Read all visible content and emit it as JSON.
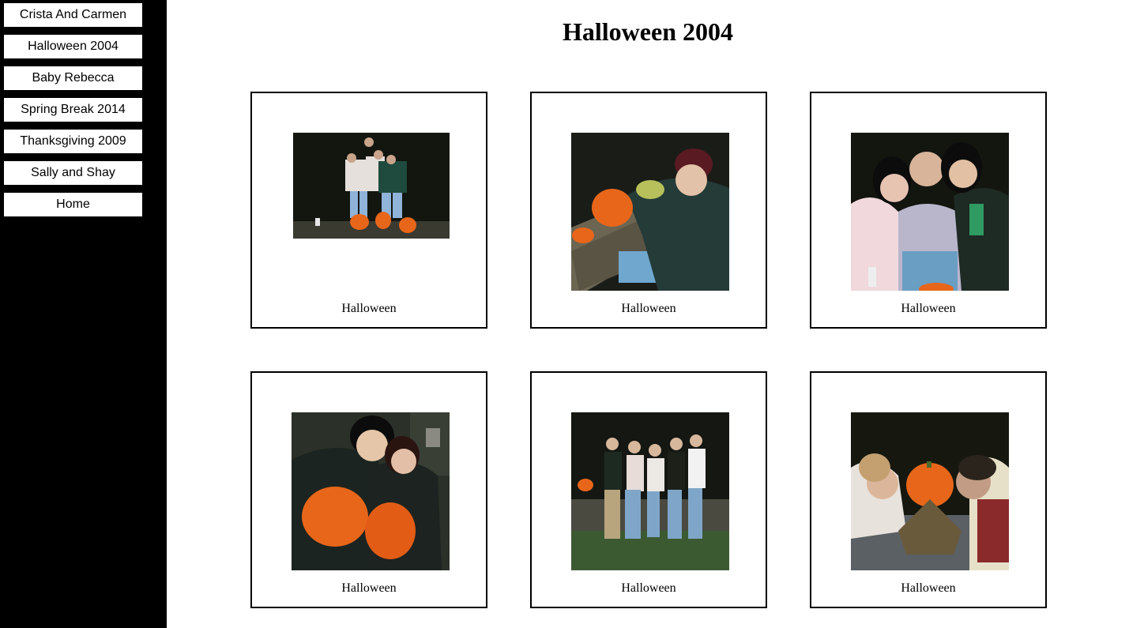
{
  "sidebar": {
    "items": [
      {
        "label": "Crista And Carmen"
      },
      {
        "label": "Halloween 2004"
      },
      {
        "label": "Baby Rebecca"
      },
      {
        "label": "Spring Break 2014"
      },
      {
        "label": "Thanksgiving 2009"
      },
      {
        "label": "Sally and Shay"
      },
      {
        "label": "Home"
      }
    ]
  },
  "page": {
    "title": "Halloween 2004"
  },
  "gallery": {
    "cards": [
      {
        "caption": "Halloween",
        "image": "group-photo-with-carved-pumpkins-on-table"
      },
      {
        "caption": "Halloween",
        "image": "person-carving-pumpkin-at-picnic-table"
      },
      {
        "caption": "Halloween",
        "image": "three-friends-smiling-closeup"
      },
      {
        "caption": "Halloween",
        "image": "two-friends-holding-pumpkins"
      },
      {
        "caption": "Halloween",
        "image": "group-of-five-standing-outdoors"
      },
      {
        "caption": "Halloween",
        "image": "two-people-kissing-pumpkin"
      }
    ]
  },
  "colors": {
    "sidebar_bg": "#000000",
    "nav_bg": "#ffffff",
    "card_border": "#000000",
    "pumpkin": "#e8661a"
  }
}
